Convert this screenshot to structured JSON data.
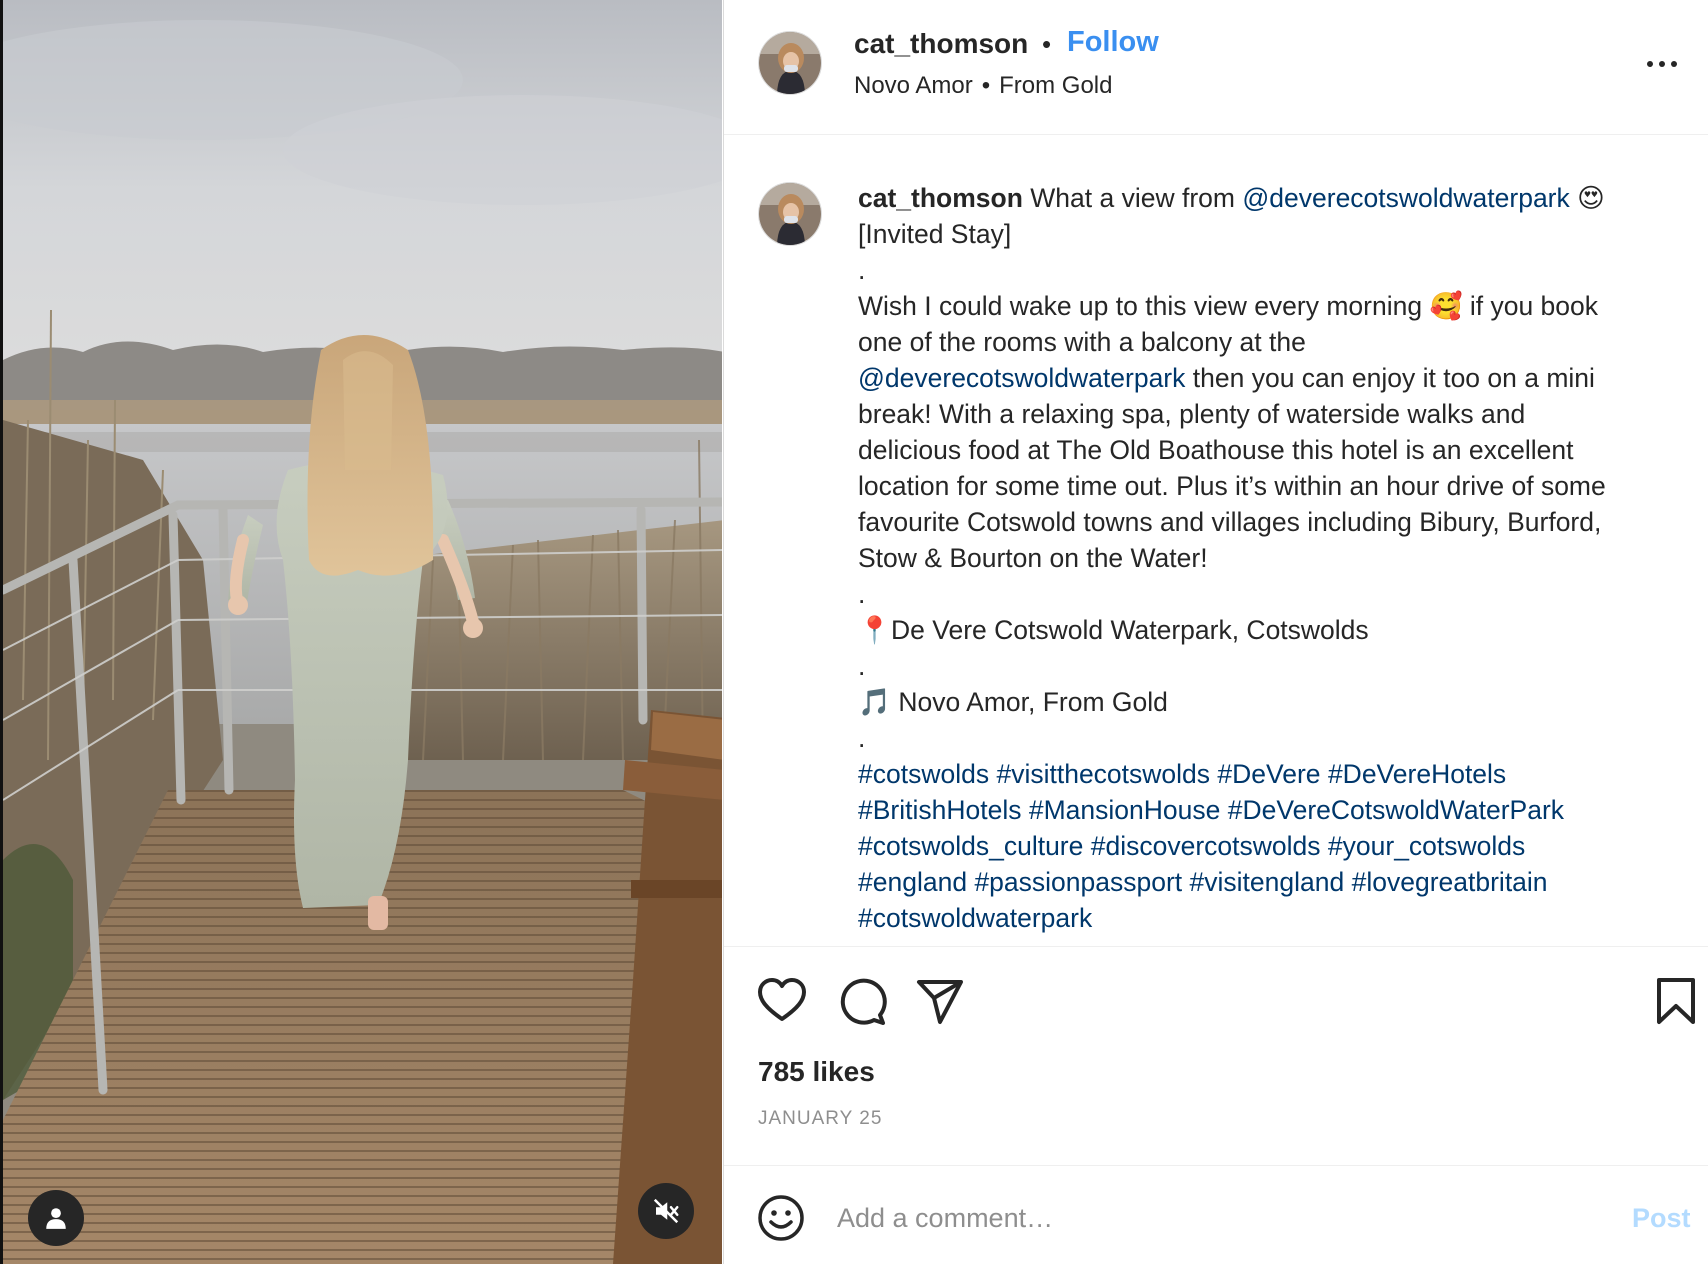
{
  "header": {
    "username": "cat_thomson",
    "separator": "•",
    "follow_label": "Follow",
    "audio_artist": "Novo Amor",
    "audio_separator": "•",
    "audio_track": "From Gold"
  },
  "caption": {
    "username": "cat_thomson",
    "intro_text": "What a view from",
    "mention": "@deverecotswoldwaterpark",
    "emoji_heart_eyes": "😍",
    "invited": "[Invited Stay]",
    "dot": ".",
    "line1": "Wish I could wake up to this view every morning",
    "emoji_smiling_hearts": "🥰",
    "line1_end": "if you book",
    "line2": "one of the rooms with a balcony at the",
    "line3_end": "then you can enjoy it too on a mini",
    "line4": "break! With a relaxing spa, plenty of waterside walks and",
    "line5": "delicious food at The Old Boathouse this hotel is an excellent",
    "line6": "location for some time out. Plus it’s within an hour drive of some",
    "line7": "favourite Cotswold towns and villages including Bibury, Burford,",
    "line8": "Stow & Bourton on the Water!",
    "location_pin": "📍",
    "location": "De Vere Cotswold Waterpark, Cotswolds",
    "music_note": "🎵",
    "music": "Novo Amor, From Gold",
    "hashtags": [
      [
        "#cotswolds",
        "#visitthecotswolds",
        "#DeVere",
        "#DeVereHotels"
      ],
      [
        "#BritishHotels",
        "#MansionHouse",
        "#DeVereCotswoldWaterPark"
      ],
      [
        "#cotswolds_culture",
        "#discovercotswolds",
        "#your_cotswolds"
      ],
      [
        "#england",
        "#passionpassport",
        "#visitengland",
        "#lovegreatbritain"
      ],
      [
        "#cotswoldwaterpark"
      ]
    ]
  },
  "actions": {
    "like_icon": "heart-icon",
    "comment_icon": "comment-bubble-icon",
    "share_icon": "paper-plane-icon",
    "save_icon": "bookmark-icon"
  },
  "likes": "785 likes",
  "date": "JANUARY 25",
  "comment_box": {
    "placeholder": "Add a comment…",
    "post_label": "Post"
  },
  "media": {
    "user_tag_icon": "person-icon",
    "mute_icon": "speaker-muted-icon"
  },
  "colors": {
    "follow": "#3a8ff0",
    "link": "#00376b",
    "post_disabled": "#b3dbff",
    "secondary_text": "#8e8e8e"
  }
}
